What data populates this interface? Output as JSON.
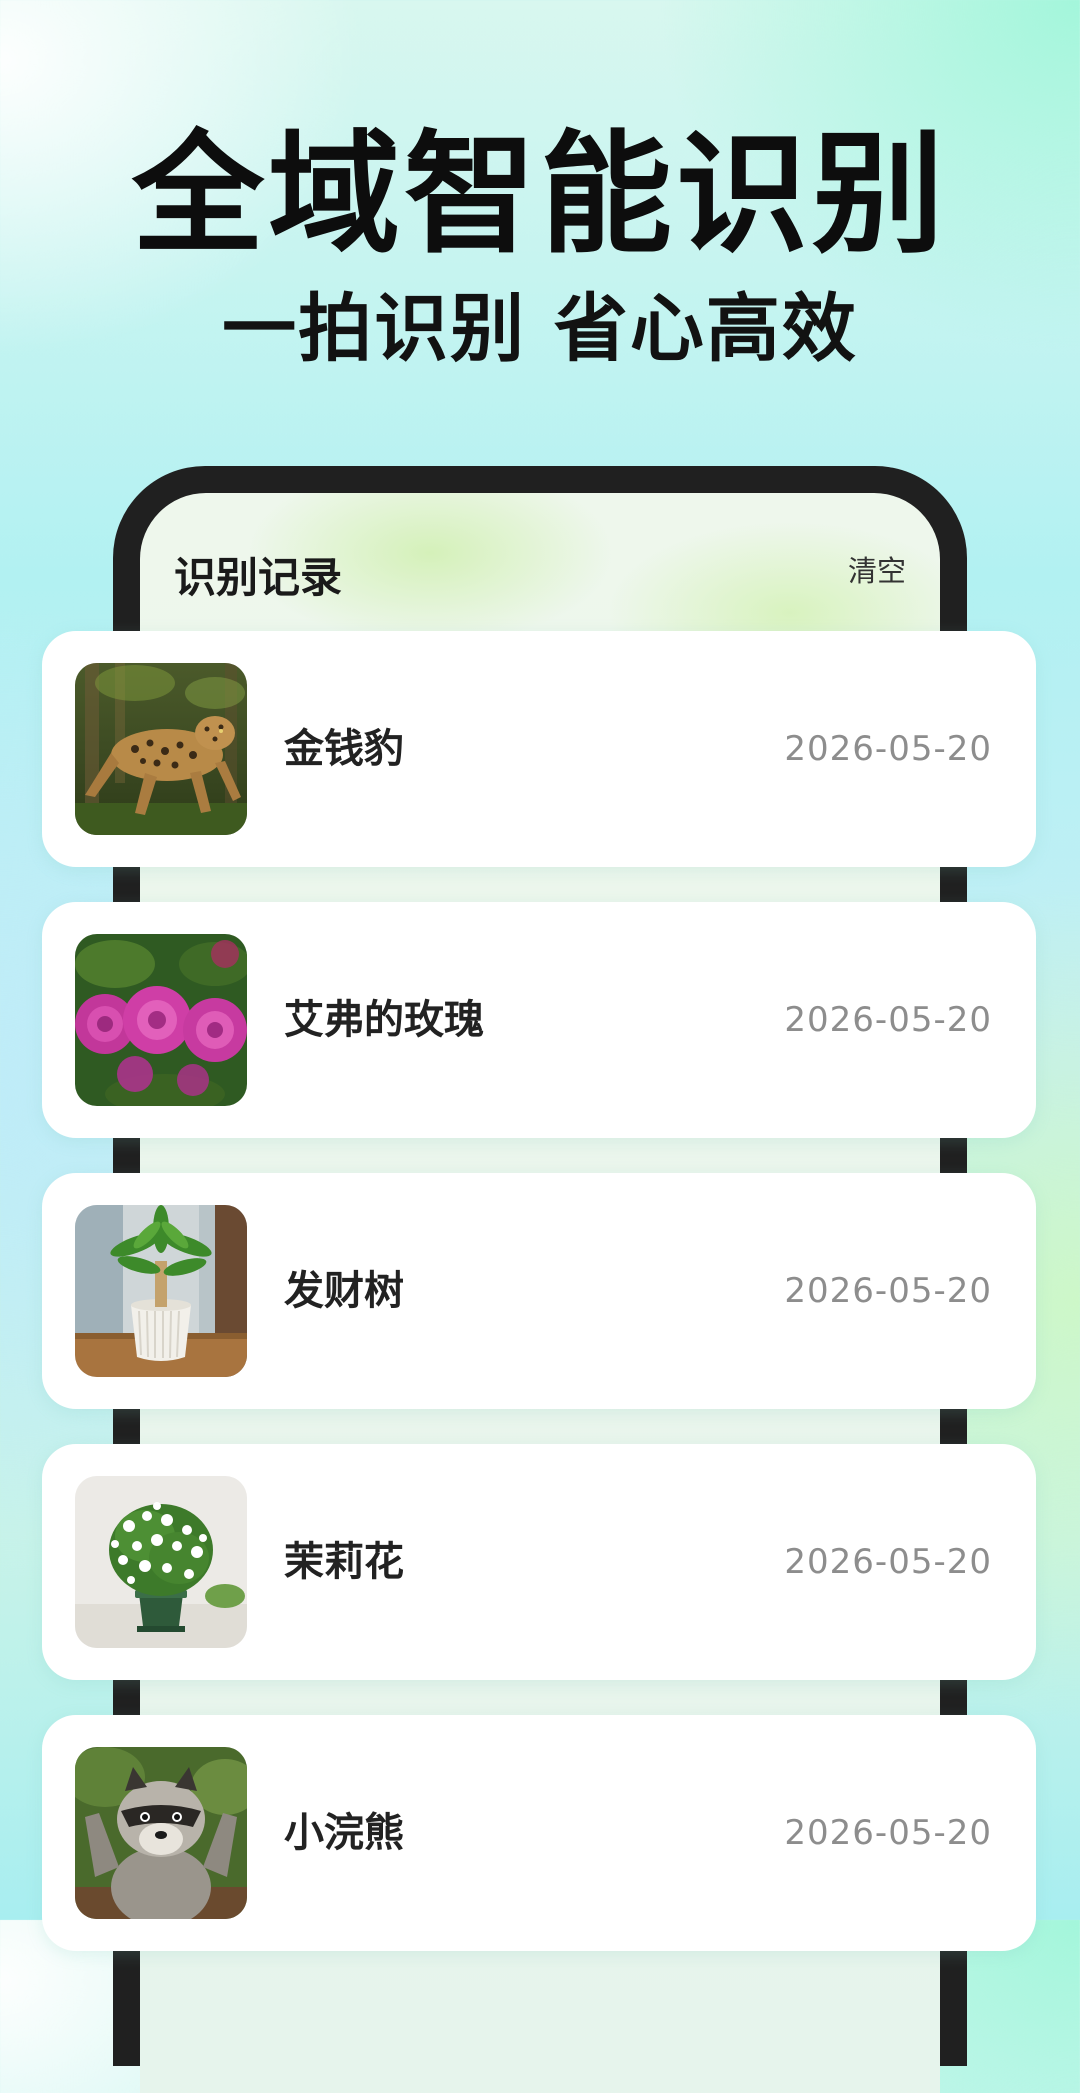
{
  "hero": {
    "title": "全域智能识别",
    "subtitle": "一拍识别 省心高效"
  },
  "screen": {
    "title": "识别记录",
    "clear_label": "清空"
  },
  "records": [
    {
      "name": "金钱豹",
      "date": "2026-05-20",
      "thumb_icon": "leopard-photo"
    },
    {
      "name": "艾弗的玫瑰",
      "date": "2026-05-20",
      "thumb_icon": "rose-photo"
    },
    {
      "name": "发财树",
      "date": "2026-05-20",
      "thumb_icon": "money-tree-photo"
    },
    {
      "name": "茉莉花",
      "date": "2026-05-20",
      "thumb_icon": "jasmine-photo"
    },
    {
      "name": "小浣熊",
      "date": "2026-05-20",
      "thumb_icon": "raccoon-photo"
    }
  ],
  "colors": {
    "title_text": "#0d0d0d",
    "phone_frame": "#202020",
    "card_background": "#ffffff",
    "date_text": "#8d8d8d"
  }
}
